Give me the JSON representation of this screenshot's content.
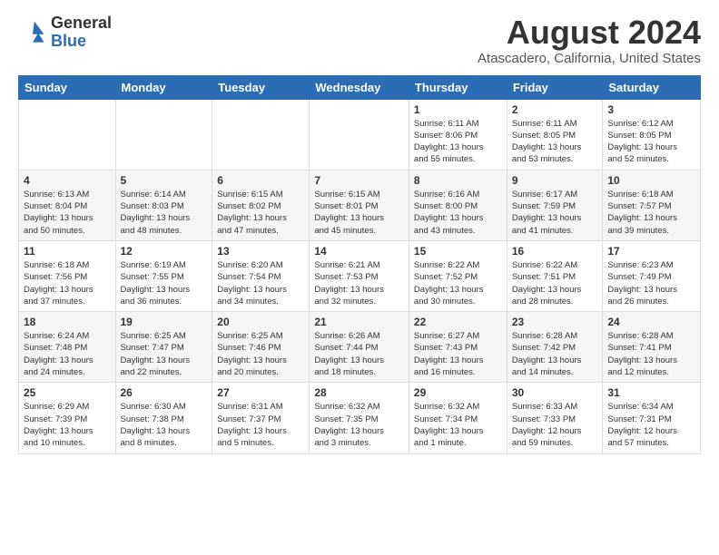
{
  "header": {
    "logo_line1": "General",
    "logo_line2": "Blue",
    "title": "August 2024",
    "subtitle": "Atascadero, California, United States"
  },
  "days_of_week": [
    "Sunday",
    "Monday",
    "Tuesday",
    "Wednesday",
    "Thursday",
    "Friday",
    "Saturday"
  ],
  "weeks": [
    [
      {
        "day": "",
        "info": ""
      },
      {
        "day": "",
        "info": ""
      },
      {
        "day": "",
        "info": ""
      },
      {
        "day": "",
        "info": ""
      },
      {
        "day": "1",
        "info": "Sunrise: 6:11 AM\nSunset: 8:06 PM\nDaylight: 13 hours\nand 55 minutes."
      },
      {
        "day": "2",
        "info": "Sunrise: 6:11 AM\nSunset: 8:05 PM\nDaylight: 13 hours\nand 53 minutes."
      },
      {
        "day": "3",
        "info": "Sunrise: 6:12 AM\nSunset: 8:05 PM\nDaylight: 13 hours\nand 52 minutes."
      }
    ],
    [
      {
        "day": "4",
        "info": "Sunrise: 6:13 AM\nSunset: 8:04 PM\nDaylight: 13 hours\nand 50 minutes."
      },
      {
        "day": "5",
        "info": "Sunrise: 6:14 AM\nSunset: 8:03 PM\nDaylight: 13 hours\nand 48 minutes."
      },
      {
        "day": "6",
        "info": "Sunrise: 6:15 AM\nSunset: 8:02 PM\nDaylight: 13 hours\nand 47 minutes."
      },
      {
        "day": "7",
        "info": "Sunrise: 6:15 AM\nSunset: 8:01 PM\nDaylight: 13 hours\nand 45 minutes."
      },
      {
        "day": "8",
        "info": "Sunrise: 6:16 AM\nSunset: 8:00 PM\nDaylight: 13 hours\nand 43 minutes."
      },
      {
        "day": "9",
        "info": "Sunrise: 6:17 AM\nSunset: 7:59 PM\nDaylight: 13 hours\nand 41 minutes."
      },
      {
        "day": "10",
        "info": "Sunrise: 6:18 AM\nSunset: 7:57 PM\nDaylight: 13 hours\nand 39 minutes."
      }
    ],
    [
      {
        "day": "11",
        "info": "Sunrise: 6:18 AM\nSunset: 7:56 PM\nDaylight: 13 hours\nand 37 minutes."
      },
      {
        "day": "12",
        "info": "Sunrise: 6:19 AM\nSunset: 7:55 PM\nDaylight: 13 hours\nand 36 minutes."
      },
      {
        "day": "13",
        "info": "Sunrise: 6:20 AM\nSunset: 7:54 PM\nDaylight: 13 hours\nand 34 minutes."
      },
      {
        "day": "14",
        "info": "Sunrise: 6:21 AM\nSunset: 7:53 PM\nDaylight: 13 hours\nand 32 minutes."
      },
      {
        "day": "15",
        "info": "Sunrise: 6:22 AM\nSunset: 7:52 PM\nDaylight: 13 hours\nand 30 minutes."
      },
      {
        "day": "16",
        "info": "Sunrise: 6:22 AM\nSunset: 7:51 PM\nDaylight: 13 hours\nand 28 minutes."
      },
      {
        "day": "17",
        "info": "Sunrise: 6:23 AM\nSunset: 7:49 PM\nDaylight: 13 hours\nand 26 minutes."
      }
    ],
    [
      {
        "day": "18",
        "info": "Sunrise: 6:24 AM\nSunset: 7:48 PM\nDaylight: 13 hours\nand 24 minutes."
      },
      {
        "day": "19",
        "info": "Sunrise: 6:25 AM\nSunset: 7:47 PM\nDaylight: 13 hours\nand 22 minutes."
      },
      {
        "day": "20",
        "info": "Sunrise: 6:25 AM\nSunset: 7:46 PM\nDaylight: 13 hours\nand 20 minutes."
      },
      {
        "day": "21",
        "info": "Sunrise: 6:26 AM\nSunset: 7:44 PM\nDaylight: 13 hours\nand 18 minutes."
      },
      {
        "day": "22",
        "info": "Sunrise: 6:27 AM\nSunset: 7:43 PM\nDaylight: 13 hours\nand 16 minutes."
      },
      {
        "day": "23",
        "info": "Sunrise: 6:28 AM\nSunset: 7:42 PM\nDaylight: 13 hours\nand 14 minutes."
      },
      {
        "day": "24",
        "info": "Sunrise: 6:28 AM\nSunset: 7:41 PM\nDaylight: 13 hours\nand 12 minutes."
      }
    ],
    [
      {
        "day": "25",
        "info": "Sunrise: 6:29 AM\nSunset: 7:39 PM\nDaylight: 13 hours\nand 10 minutes."
      },
      {
        "day": "26",
        "info": "Sunrise: 6:30 AM\nSunset: 7:38 PM\nDaylight: 13 hours\nand 8 minutes."
      },
      {
        "day": "27",
        "info": "Sunrise: 6:31 AM\nSunset: 7:37 PM\nDaylight: 13 hours\nand 5 minutes."
      },
      {
        "day": "28",
        "info": "Sunrise: 6:32 AM\nSunset: 7:35 PM\nDaylight: 13 hours\nand 3 minutes."
      },
      {
        "day": "29",
        "info": "Sunrise: 6:32 AM\nSunset: 7:34 PM\nDaylight: 13 hours\nand 1 minute."
      },
      {
        "day": "30",
        "info": "Sunrise: 6:33 AM\nSunset: 7:33 PM\nDaylight: 12 hours\nand 59 minutes."
      },
      {
        "day": "31",
        "info": "Sunrise: 6:34 AM\nSunset: 7:31 PM\nDaylight: 12 hours\nand 57 minutes."
      }
    ]
  ]
}
